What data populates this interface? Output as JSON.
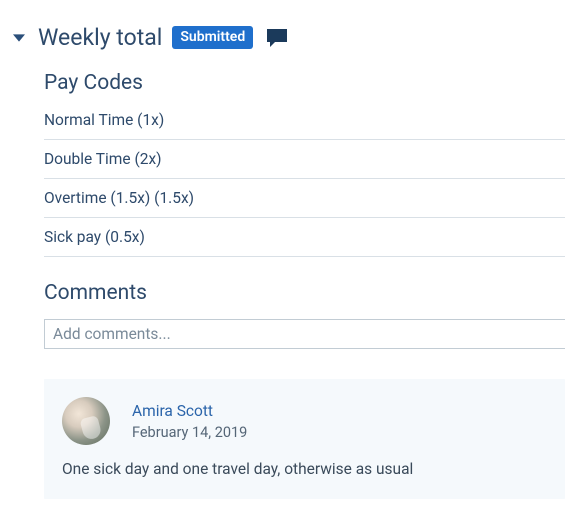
{
  "header": {
    "title": "Weekly total",
    "badge": "Submitted"
  },
  "paycodes": {
    "title": "Pay Codes",
    "items": [
      "Normal Time (1x)",
      "Double Time (2x)",
      "Overtime (1.5x) (1.5x)",
      "Sick pay (0.5x)"
    ]
  },
  "comments": {
    "title": "Comments",
    "placeholder": "Add comments...",
    "entries": [
      {
        "author": "Amira Scott",
        "date": "February 14, 2019",
        "body": "One sick day and one travel day, otherwise as usual"
      }
    ]
  }
}
